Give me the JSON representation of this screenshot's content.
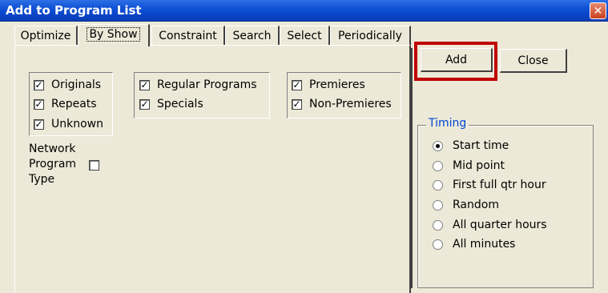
{
  "window": {
    "title": "Add to Program List"
  },
  "tabs": [
    {
      "label": "Optimize",
      "active": false
    },
    {
      "label": "By Show",
      "active": true
    },
    {
      "label": "Constraint",
      "active": false
    },
    {
      "label": "Search",
      "active": false
    },
    {
      "label": "Select",
      "active": false
    },
    {
      "label": "Periodically",
      "active": false
    }
  ],
  "by_show": {
    "originals_group": [
      {
        "label": "Originals",
        "checked": true
      },
      {
        "label": "Repeats",
        "checked": true
      },
      {
        "label": "Unknown",
        "checked": true
      }
    ],
    "program_group": [
      {
        "label": "Regular Programs",
        "checked": true
      },
      {
        "label": "Specials",
        "checked": true
      }
    ],
    "premiere_group": [
      {
        "label": "Premieres",
        "checked": true
      },
      {
        "label": "Non-Premieres",
        "checked": true
      }
    ],
    "network_program_type": {
      "line1": "Network",
      "line2": "Program",
      "line3": "Type",
      "checked": false
    }
  },
  "buttons": {
    "add": "Add",
    "close": "Close"
  },
  "timing": {
    "legend": "Timing",
    "options": [
      {
        "label": "Start time",
        "selected": true
      },
      {
        "label": "Mid point",
        "selected": false
      },
      {
        "label": "First full qtr hour",
        "selected": false
      },
      {
        "label": "Random",
        "selected": false
      },
      {
        "label": "All quarter hours",
        "selected": false
      },
      {
        "label": "All minutes",
        "selected": false
      }
    ]
  },
  "colors": {
    "titlebar": "#0a46cc",
    "highlight": "#c00000",
    "legend": "#0046d5"
  }
}
